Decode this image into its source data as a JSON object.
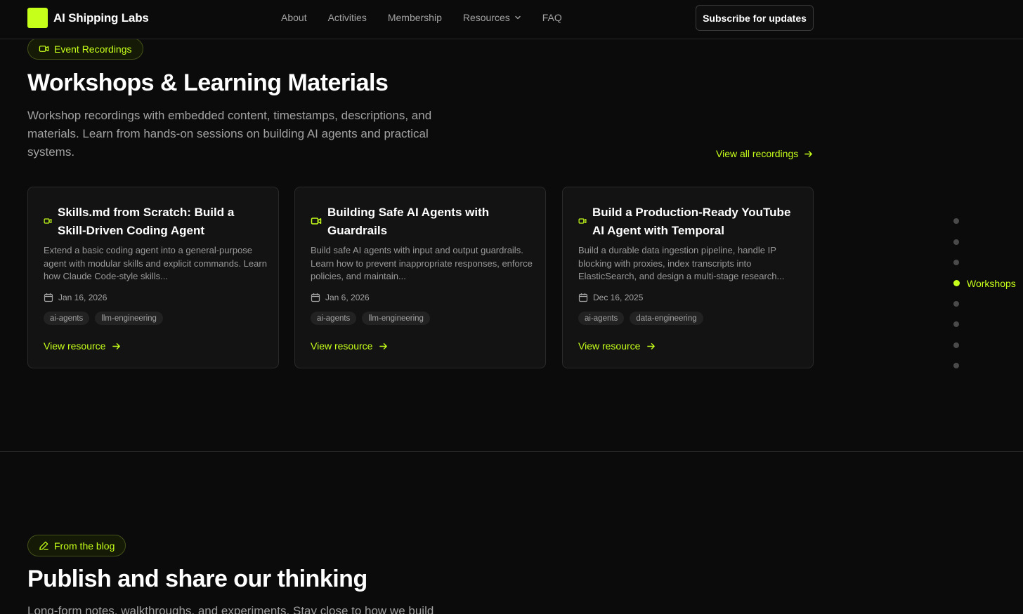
{
  "header": {
    "brand": "AI Shipping Labs",
    "nav": [
      "About",
      "Activities",
      "Membership",
      "Resources",
      "FAQ"
    ],
    "subscribe_label": "Subscribe for updates"
  },
  "workshops": {
    "badge": "Event Recordings",
    "title": "Workshops & Learning Materials",
    "description": "Workshop recordings with embedded content, timestamps, descriptions, and materials. Learn from hands-on sessions on building AI agents and practical systems.",
    "view_all": "View all recordings",
    "cards": [
      {
        "title": "Skills.md from Scratch: Build a Skill-Driven Coding Agent",
        "description": "Extend a basic coding agent into a general-purpose agent with modular skills and explicit commands. Learn how Claude Code-style skills...",
        "date": "Jan 16, 2026",
        "tags": [
          "ai-agents",
          "llm-engineering"
        ],
        "link": "View resource"
      },
      {
        "title": "Building Safe AI Agents with Guardrails",
        "description": "Build safe AI agents with input and output guardrails. Learn how to prevent inappropriate responses, enforce policies, and maintain...",
        "date": "Jan 6, 2026",
        "tags": [
          "ai-agents",
          "llm-engineering"
        ],
        "link": "View resource"
      },
      {
        "title": "Build a Production-Ready YouTube AI Agent with Temporal",
        "description": "Build a durable data ingestion pipeline, handle IP blocking with proxies, index transcripts into ElasticSearch, and design a multi-stage research...",
        "date": "Dec 16, 2025",
        "tags": [
          "ai-agents",
          "data-engineering"
        ],
        "link": "View resource"
      }
    ]
  },
  "dot_nav": {
    "count": 8,
    "active_index": 3,
    "active_label": "Workshops"
  },
  "blog": {
    "badge": "From the blog",
    "title": "Publish and share our thinking",
    "description": "Long-form notes, walkthroughs, and experiments. Stay close to how we build"
  },
  "colors": {
    "accent": "#c6ff1a",
    "background": "#0b0b0b",
    "card": "#131313"
  }
}
